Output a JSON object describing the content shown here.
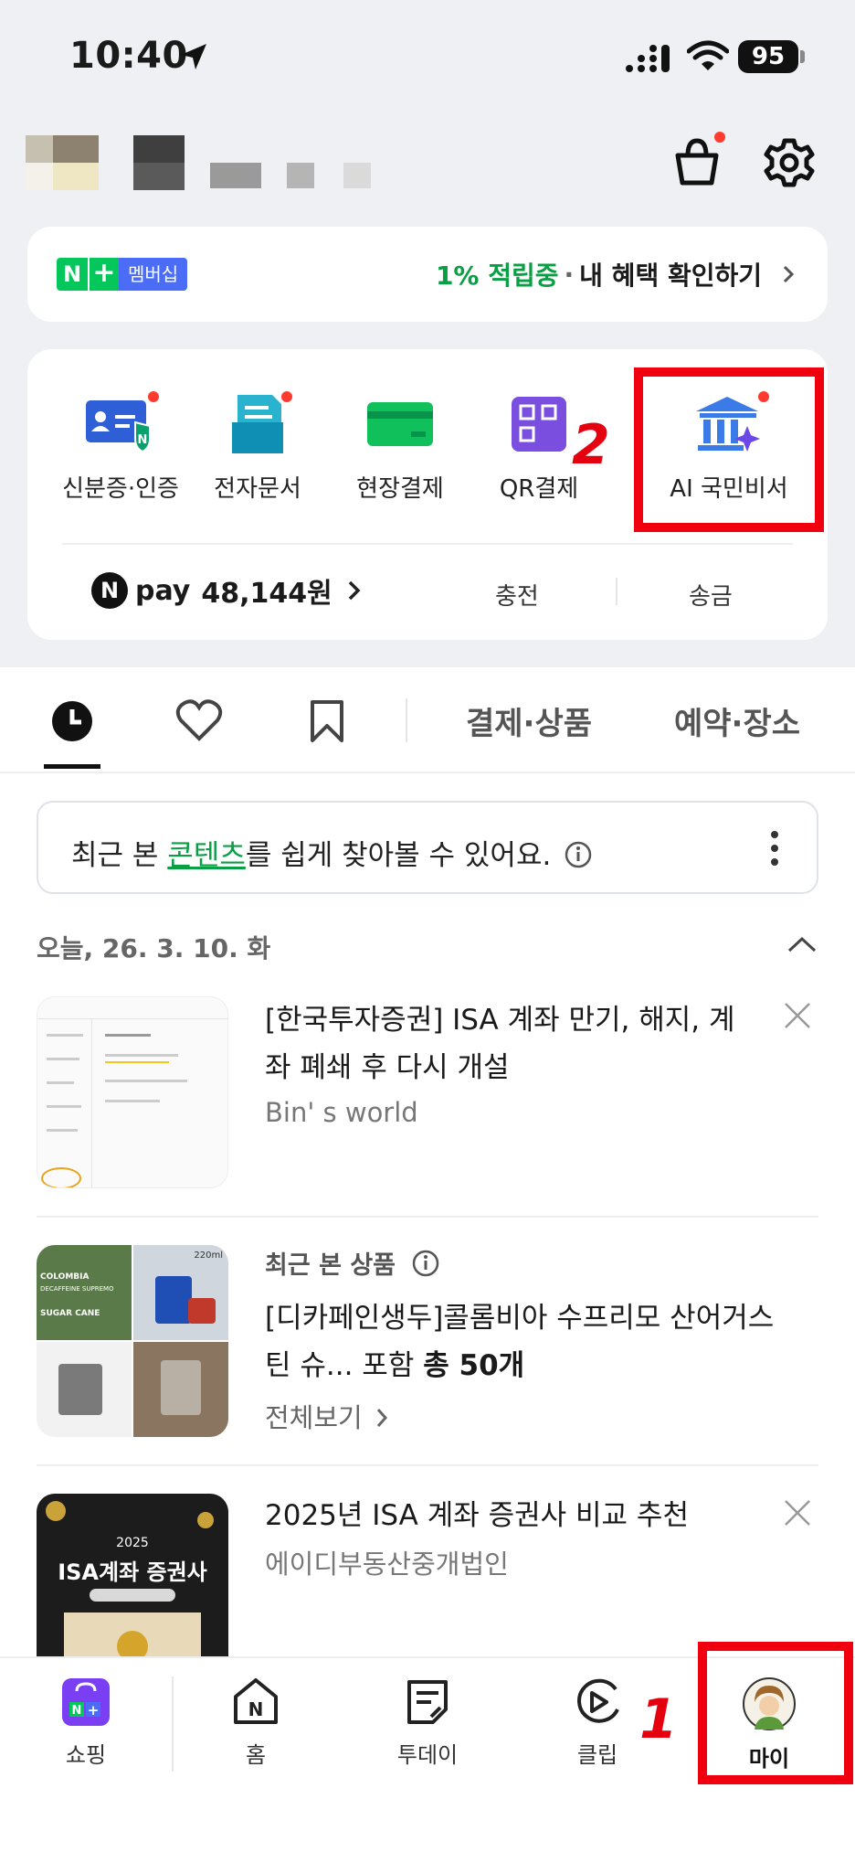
{
  "status": {
    "time": "10:40",
    "battery": "95"
  },
  "header": {
    "cart_icon": "cart-icon",
    "settings_icon": "gear-icon"
  },
  "membership": {
    "badge_label": "멤버십",
    "rate": "1% 적립중",
    "dot": "·",
    "link": "내 혜택 확인하기"
  },
  "quick": {
    "items": [
      {
        "label": "신분증·인증",
        "icon": "id-card-icon"
      },
      {
        "label": "전자문서",
        "icon": "document-icon"
      },
      {
        "label": "현장결제",
        "icon": "card-payment-icon"
      },
      {
        "label": "QR결제",
        "icon": "qr-icon"
      },
      {
        "label": "AI 국민비서",
        "icon": "government-building-icon"
      }
    ],
    "pay_logo": "pay",
    "pay_amount": "48,144원",
    "charge": "충전",
    "send": "송금"
  },
  "annotations": {
    "one": "1",
    "two": "2"
  },
  "tabs": {
    "payment_products": "결제·상품",
    "reservation_places": "예약·장소"
  },
  "hint": {
    "pre": "최근 본 ",
    "link": "콘텐츠",
    "post": "를 쉽게 찾아볼 수 있어요."
  },
  "date_header": "오늘, 26. 3. 10. 화",
  "feed": [
    {
      "title_line1": "[한국투자증권] ISA 계좌 만기, 해지, 계",
      "title_line2": "좌 폐쇄 후 다시 개설",
      "source": "Bin' s world"
    },
    {
      "label": "최근 본 상품",
      "title_line1": "[디카페인생두]콜롬비아 수프리모 산어거스",
      "title_line2_pre": "틴 슈... 포함 ",
      "title_line2_bold": "총 50개",
      "more": "전체보기",
      "thumb_text_1": "COLOMBIA",
      "thumb_text_2": "DECAFFEINE SUPREMO",
      "thumb_text_3": "SUGAR CANE",
      "thumb_text_4": "220ml"
    },
    {
      "title_line1": "2025년 ISA 계좌 증권사 비교 추천",
      "source": "에이디부동산중개법인",
      "thumb_year": "2025",
      "thumb_title": "ISA계좌 증권사"
    }
  ],
  "nav": [
    {
      "label": "쇼핑"
    },
    {
      "label": "홈"
    },
    {
      "label": "투데이"
    },
    {
      "label": "클립"
    },
    {
      "label": "마이"
    }
  ],
  "colors": {
    "accent_green": "#03c75a",
    "annotation_red": "#f0000f"
  }
}
